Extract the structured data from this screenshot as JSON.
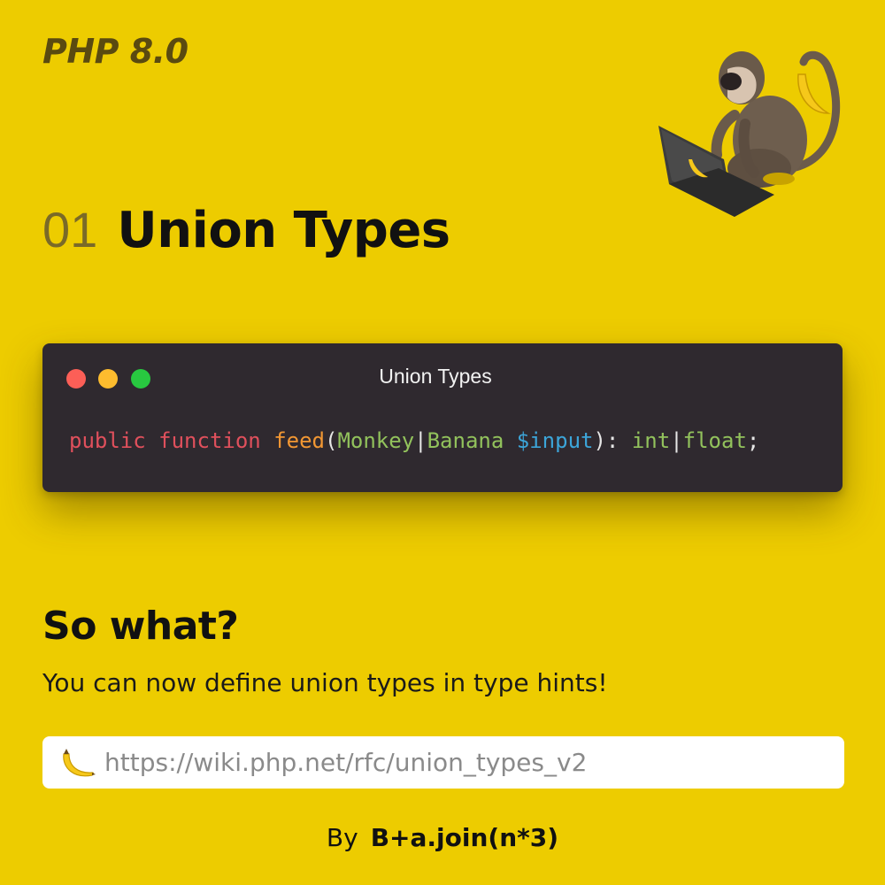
{
  "header": {
    "brand": "PHP 8.0"
  },
  "heading": {
    "number": "01",
    "title": "Union Types"
  },
  "code_window": {
    "title": "Union Types",
    "tokens": [
      {
        "text": "public",
        "kind": "kw"
      },
      {
        "text": " ",
        "kind": "punc"
      },
      {
        "text": "function",
        "kind": "kw"
      },
      {
        "text": " ",
        "kind": "punc"
      },
      {
        "text": "feed",
        "kind": "fn"
      },
      {
        "text": "(",
        "kind": "punc"
      },
      {
        "text": "Monkey",
        "kind": "type"
      },
      {
        "text": "|",
        "kind": "punc"
      },
      {
        "text": "Banana",
        "kind": "type"
      },
      {
        "text": " ",
        "kind": "punc"
      },
      {
        "text": "$input",
        "kind": "var"
      },
      {
        "text": "): ",
        "kind": "punc"
      },
      {
        "text": "int",
        "kind": "type"
      },
      {
        "text": "|",
        "kind": "punc"
      },
      {
        "text": "float",
        "kind": "type"
      },
      {
        "text": ";",
        "kind": "punc"
      }
    ]
  },
  "section": {
    "heading": "So what?",
    "description": "You can now define union types in type hints!"
  },
  "link": {
    "icon": "banana-icon",
    "url": "https://wiki.php.net/rfc/union_types_v2"
  },
  "footer": {
    "by_label": "By",
    "author": "B+a.join(n*3)"
  },
  "colors": {
    "background": "#edcc00",
    "code_background": "#2f292f",
    "keyword": "#e0505c",
    "function": "#f29733",
    "type": "#92c25c",
    "variable": "#3ca5d9"
  }
}
